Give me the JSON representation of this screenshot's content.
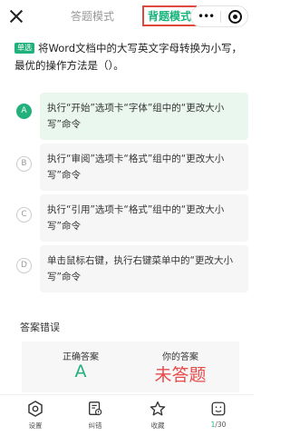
{
  "header": {
    "tab_answer": "答题模式",
    "tab_recite": "背题模式",
    "capsule_dots": "•••"
  },
  "question": {
    "type_badge": "单选",
    "text": "将Word文档中的大写英文字母转换为小写，最优的操作方法是（）。"
  },
  "options": [
    {
      "letter": "A",
      "text": "执行“开始”选项卡“字体”组中的“更改大小写”命令",
      "correct": true
    },
    {
      "letter": "B",
      "text": "执行“审阅”选项卡“格式”组中的“更改大小写”命令",
      "correct": false
    },
    {
      "letter": "C",
      "text": "执行“引用”选项卡“格式”组中的“更改大小写”命令",
      "correct": false
    },
    {
      "letter": "D",
      "text": "单击鼠标右键，执行右键菜单中的“更改大小写”命令",
      "correct": false
    }
  ],
  "result": {
    "title": "答案错误",
    "correct_label": "正确答案",
    "correct_value": "A",
    "yours_label": "你的答案",
    "yours_value": "未答题"
  },
  "bottom_nav": {
    "settings": "设置",
    "report": "纠错",
    "favorite": "收藏",
    "progress_current": "1",
    "progress_total": "/30"
  },
  "colors": {
    "accent": "#22b07d",
    "error": "#e84a4a",
    "highlight_border": "#e0473d"
  }
}
